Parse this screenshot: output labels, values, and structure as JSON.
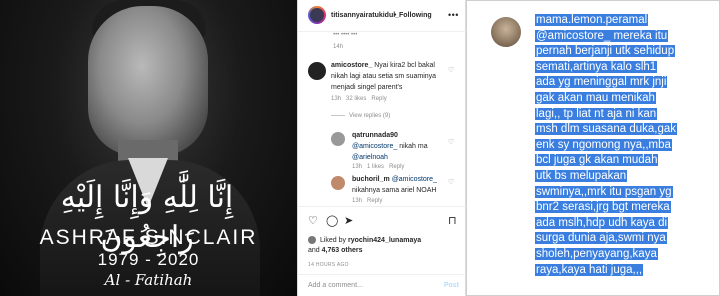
{
  "photo": {
    "arabic": "إِنَّا لِلَّٰهِ وَإِنَّا إِلَيْهِ رَاجِعُونَ",
    "name": "ASHRAF SINCLAIR",
    "years": "1979 - 2020",
    "fatihah": "Al - Fatihah"
  },
  "instagram": {
    "username": "titisannyairatukidul_",
    "follow_label": "Following",
    "more": "•••",
    "prev_text": "••• •••• •••",
    "prev_time": "14h",
    "comments": [
      {
        "user": "amicostore_",
        "text": "Nyai kira2 bcl bakal nikah lagi atau setia sm suaminya menjadi singel parent's",
        "time": "13h",
        "likes": "32 likes",
        "reply": "Reply"
      }
    ],
    "view_replies": "View replies (9)",
    "replies": [
      {
        "user": "qatrunnada90",
        "mention": "@amicostore_",
        "text": "nikah ma",
        "mention2": "@arielnoah",
        "time": "13h",
        "likes": "1 likes",
        "reply": "Reply"
      },
      {
        "user": "buchoril_m",
        "mention": "@amicostore_",
        "text": "nikahnya sama ariel NOAH",
        "time": "13h",
        "likes": "",
        "reply": "Reply"
      }
    ],
    "liked_by": "Liked by",
    "liked_user": "ryochin424_lunamaya",
    "liked_and": "and",
    "liked_count": "4,763 others",
    "post_time": "14 HOURS AGO",
    "comment_placeholder": "Add a comment...",
    "post_label": "Post",
    "icons": [
      "heart-icon",
      "comment-icon",
      "share-icon",
      "bookmark-icon"
    ]
  },
  "right_comment": {
    "lines": [
      "mama.lemon.peramal",
      "@amicostore_ mereka itu",
      "pernah berjanji utk sehidup",
      "semati,artinya kalo slh1",
      "ada yg meninggal mrk jnji",
      "gak akan mau menikah",
      "lagi,, tp liat nt aja ni kan",
      "msh dlm suasana duka,gak",
      "enk sy ngomong nya,,mba",
      "bcl juga gk akan mudah",
      "utk bs melupakan",
      "swminya,,mrk itu psgan yg",
      "bnr2 serasi,jrg bgt mereka",
      "ada mslh,hdp udh kaya di",
      "surga dunia aja,swmi nya",
      "sholeh,penyayang,kaya",
      "raya,kaya hati juga,,,"
    ],
    "highlight_color": "#3a7fe0"
  }
}
